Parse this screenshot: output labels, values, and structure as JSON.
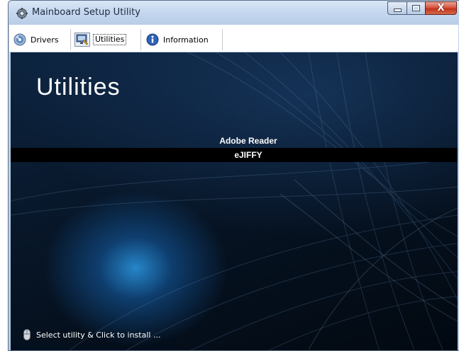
{
  "window": {
    "title": "Mainboard Setup Utility"
  },
  "caption_buttons": {
    "close_glyph": "X"
  },
  "tabs": [
    {
      "label": "Drivers",
      "icon": "drivers-disc-icon",
      "selected": false
    },
    {
      "label": "Utilities",
      "icon": "utilities-monitor-icon",
      "selected": true
    },
    {
      "label": "Information",
      "icon": "information-icon",
      "selected": false
    }
  ],
  "content": {
    "heading": "Utilities",
    "utilities": [
      {
        "label": "Adobe Reader",
        "selected": false
      },
      {
        "label": "eJIFFY",
        "selected": true
      }
    ],
    "status_text": "Select utility & Click to install ..."
  },
  "colors": {
    "background_dark": "#071526",
    "glow_blue": "#288cd2",
    "selected_row": "#000000",
    "text": "#ffffff"
  }
}
